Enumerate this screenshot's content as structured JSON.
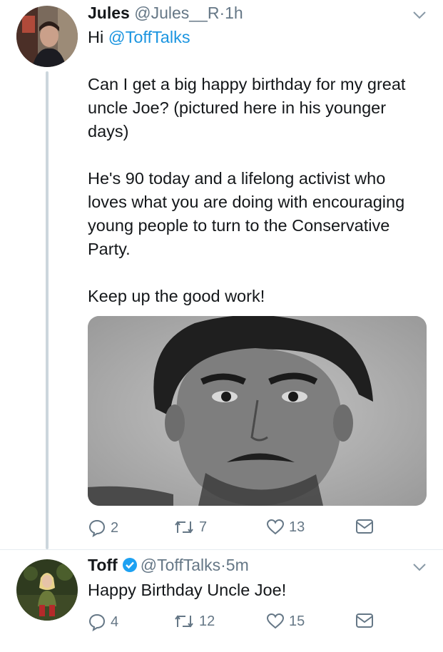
{
  "tweets": [
    {
      "name": "Jules",
      "handle": "@Jules__R",
      "sep": "·",
      "time": "1h",
      "greeting": "Hi",
      "mention": "@ToffTalks",
      "paragraphs": [
        "Can I get a big happy birthday for my great uncle Joe? (pictured here in his younger days)",
        "He's 90 today and a lifelong activist who loves what you are doing with encouraging young people to turn to the Conservative Party.",
        "Keep up the good work!"
      ],
      "replies": "2",
      "retweets": "7",
      "likes": "13"
    },
    {
      "name": "Toff",
      "handle": "@ToffTalks",
      "sep": "·",
      "time": "5m",
      "text": "Happy Birthday Uncle Joe!",
      "replies": "4",
      "retweets": "12",
      "likes": "15"
    }
  ],
  "colors": {
    "text": "#14171a",
    "muted": "#657786",
    "link": "#1b95e0",
    "verified": "#1da1f2",
    "thread_line": "#ccd6dd"
  },
  "icons": [
    "chevron-down-icon",
    "reply-icon",
    "retweet-icon",
    "like-icon",
    "dm-icon",
    "verified-badge-icon"
  ]
}
